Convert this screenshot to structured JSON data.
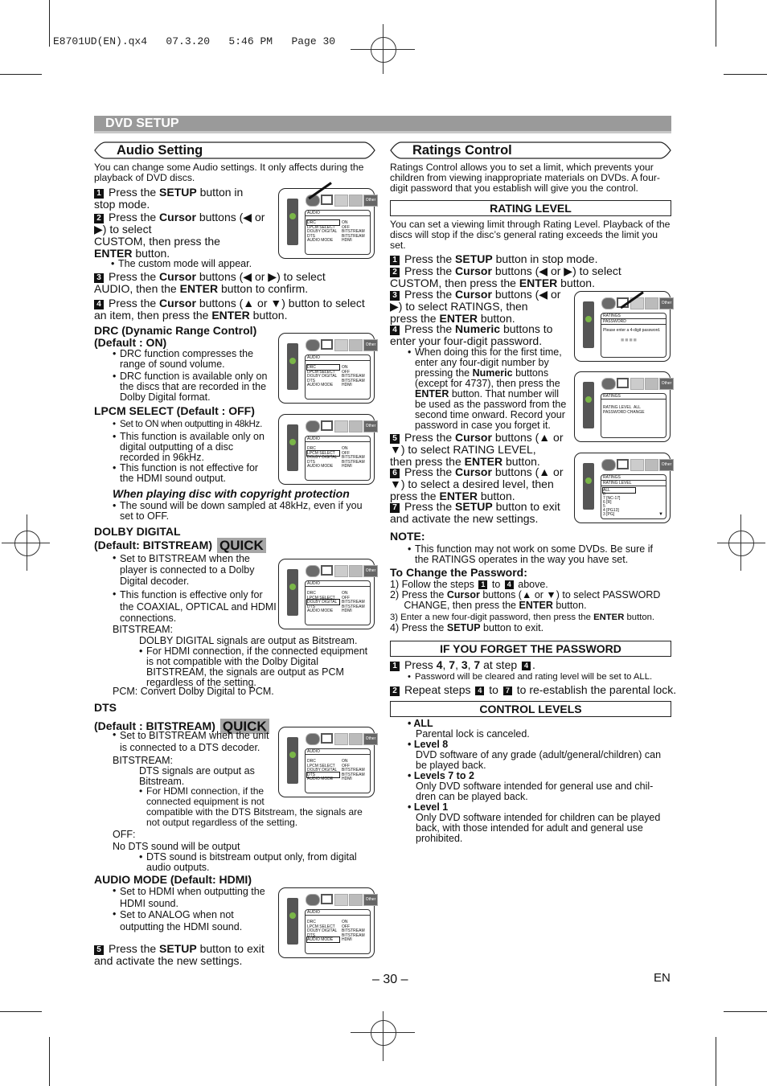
{
  "slug": "E8701UD(EN).qx4   07.3.20   5:46 PM   Page 30",
  "section_title": "DVD SETUP",
  "audio": {
    "title": "Audio Setting",
    "intro": "You can change some Audio settings. It only affects during the playback of DVD discs.",
    "steps": [
      {
        "n": "1",
        "html": "Press the <b>SETUP</b> button in<br>stop mode."
      },
      {
        "n": "2",
        "html": "Press the <b>Cursor</b> buttons (◀ or<br>▶) to select<br>CUSTOM, then press the<br><b>ENTER</b> button."
      },
      {
        "n": "3",
        "html": "Press the <b>Cursor</b> buttons (◀ or ▶) to select<br>AUDIO, then the <b>ENTER</b> button to confirm."
      },
      {
        "n": "4",
        "html": "Press the <b>Cursor</b> buttons (▲ or ▼) button to select<br>an item, then press the <b>ENTER</b> button."
      },
      {
        "n": "5",
        "html": "Press the <b>SETUP</b> button to exit<br>and activate the new settings."
      }
    ],
    "step2_note": "The custom mode will appear.",
    "drc": {
      "heading1": "DRC (Dynamic Range Control)",
      "heading2": "(Default : ON)",
      "bullets": [
        "DRC function compresses the<br>range of sound volume.",
        "DRC function is available only on<br>the discs that are recorded in the<br>Dolby Digital format."
      ]
    },
    "lpcm": {
      "heading": "LPCM SELECT (Default : OFF)",
      "bullets": [
        "Set to ON when outputting in 48kHz.",
        "This function is available only on<br>digital outputting of a disc<br>recorded in 96kHz.",
        "This function is not effective for<br>the HDMI sound output."
      ],
      "copyright_heading": "When playing disc with copyright protection",
      "copyright_bullet": "The sound will be down sampled at 48kHz, even if you<br>set to OFF."
    },
    "dolby": {
      "heading1": "DOLBY DIGITAL",
      "heading2": "(Default: BITSTREAM)",
      "quick": "QUICK",
      "bullets": [
        "Set to BITSTREAM when the<br>player is connected to a Dolby<br>Digital decoder.",
        "This function is effective only for<br>the COAXIAL, OPTICAL and HDMI<br>connections."
      ],
      "bitstream_label": "BITSTREAM:",
      "bitstream_text": "DOLBY DIGITAL signals are output as Bitstream.",
      "bitstream_bullet": "For HDMI connection, if the connected equipment<br>is not compatible with the Dolby Digital<br>BITSTREAM, the signals are output as PCM<br>regardless of the setting.",
      "pcm": "PCM: Convert Dolby Digital to PCM."
    },
    "dts": {
      "heading1": "DTS",
      "heading2": "(Default : BITSTREAM)",
      "quick": "QUICK",
      "bullet": "Set to BITSTREAM when the unit<br>is connected to a DTS decoder.",
      "bitstream_label": "BITSTREAM:",
      "bitstream_text": "DTS signals are output as<br>Bitstream.",
      "bitstream_bullet": "For HDMI connection, if the<br>connected equipment is not<br>compatible with the DTS Bitstream, the signals are<br>not output regardless of the setting.",
      "off_label": "OFF:",
      "off_text": "No DTS sound will be output",
      "off_bullet": "DTS sound is bitstream output only, from digital<br>audio outputs."
    },
    "audio_mode": {
      "heading": "AUDIO MODE (Default: HDMI)",
      "bullets": [
        "Set to HDMI when outputting the<br>HDMI sound.",
        "Set to ANALOG when not<br>outputting the HDMI sound."
      ]
    }
  },
  "osd": {
    "icon_other": "Other",
    "audio_title": "AUDIO",
    "audio_rows": [
      {
        "k": "DRC",
        "v": "ON"
      },
      {
        "k": "LPCM SELECT",
        "v": "OFF"
      },
      {
        "k": "DOLBY DIGITAL",
        "v": "BITSTREAM"
      },
      {
        "k": "DTS",
        "v": "BITSTREAM"
      },
      {
        "k": "AUDIO MODE",
        "v": "HDMI"
      }
    ],
    "ratings_title": "RATINGS",
    "password_title": "PASSWORD",
    "password_prompt": "Please enter a 4-digit password.",
    "ratings_rows": [
      {
        "k": "RATING LEVEL",
        "v": "ALL"
      },
      {
        "k": "PASSWORD CHANGE",
        "v": ""
      }
    ],
    "rating_level_title": "RATING LEVEL",
    "rating_levels": [
      "ALL",
      "8",
      "7 [NC-17]",
      "6 [R]",
      "5",
      "4 [PG13]",
      "3 [PG]"
    ]
  },
  "ratings": {
    "title": "Ratings Control",
    "intro": "Ratings Control allows you to set a limit, which prevents your children from viewing inappropriate materials on DVDs. A four-digit password that you establish will give you the control.",
    "rating_level_header": "RATING LEVEL",
    "rating_level_intro": "You can set a viewing limit through Rating Level. Playback of the discs will stop if the disc’s general rating exceeds the limit you set.",
    "steps": [
      {
        "n": "1",
        "html": "Press the <b>SETUP</b> button in stop mode."
      },
      {
        "n": "2",
        "html": "Press the <b>Cursor</b> buttons (◀ or ▶) to select<br>CUSTOM, then press the <b>ENTER</b> button."
      },
      {
        "n": "3",
        "html": "Press the <b>Cursor</b> buttons (◀ or<br>▶) to select RATINGS, then<br>press the <b>ENTER</b> button."
      },
      {
        "n": "4",
        "html": "Press the <b>Numeric</b> buttons to<br>enter your four-digit password."
      },
      {
        "n": "5",
        "html": "Press the <b>Cursor</b> buttons (▲ or<br>▼) to select RATING LEVEL,<br>then press the <b>ENTER</b> button."
      },
      {
        "n": "6",
        "html": "Press the <b>Cursor</b> buttons (▲ or<br>▼) to select a desired level, then<br>press the <b>ENTER</b> button."
      },
      {
        "n": "7",
        "html": "Press the <b>SETUP</b> button to exit<br>and activate the new settings."
      }
    ],
    "step4_bullet": "When doing this for the first time,<br>enter any four-digit number by<br>pressing the <b>Numeric</b> buttons<br>(except for 4737), then press the<br><b>ENTER</b> button. That number will<br>be used as the password from the<br>second time onward. Record your<br>password in case you forget it.",
    "note_heading": "NOTE:",
    "note_bullet": "This function may not work on some DVDs. Be sure if<br>the RATINGS operates in the way you have set.",
    "change_heading": "To Change the Password:",
    "change_steps": [
      "1)  Follow the steps <span class='num sm'>1</span> to <span class='num sm'>4</span> above.",
      "2)  Press the <b>Cursor</b> buttons (▲ or ▼) to select PASSWORD<br>&nbsp;&nbsp;&nbsp;&nbsp;&nbsp;CHANGE, then press the <b>ENTER</b> button.",
      "<span style='font-size:11.3px'>3)  Enter a new four-digit password, then press the <b>ENTER</b> button.</span>",
      "4)  Press the <b>SETUP</b> button to exit."
    ],
    "forget_header": "IF YOU FORGET THE PASSWORD",
    "forget_step1": "Press <b>4</b>, <b>7</b>, <b>3</b>, <b>7</b> at step <span class='num sm'>4</span>.",
    "forget_bullet": "Password will be cleared and rating level will be set to ALL.",
    "forget_step2": "Repeat steps <span class='num sm'>4</span> to <span class='num sm'>7</span> to re-establish the parental lock.",
    "levels_header": "CONTROL LEVELS",
    "levels": [
      {
        "name": "ALL",
        "desc": "Parental lock is canceled."
      },
      {
        "name": "Level 8",
        "desc": "DVD software of any grade (adult/general/children) can<br>be played back."
      },
      {
        "name": "Levels 7 to 2",
        "desc": "Only DVD software intended for general use and chil-<br>dren can be played back."
      },
      {
        "name": "Level 1",
        "desc": "Only DVD software intended for children can be played<br>back, with those intended for adult and general use<br>prohibited."
      }
    ]
  },
  "footer": {
    "page": "– 30 –",
    "lang": "EN"
  }
}
